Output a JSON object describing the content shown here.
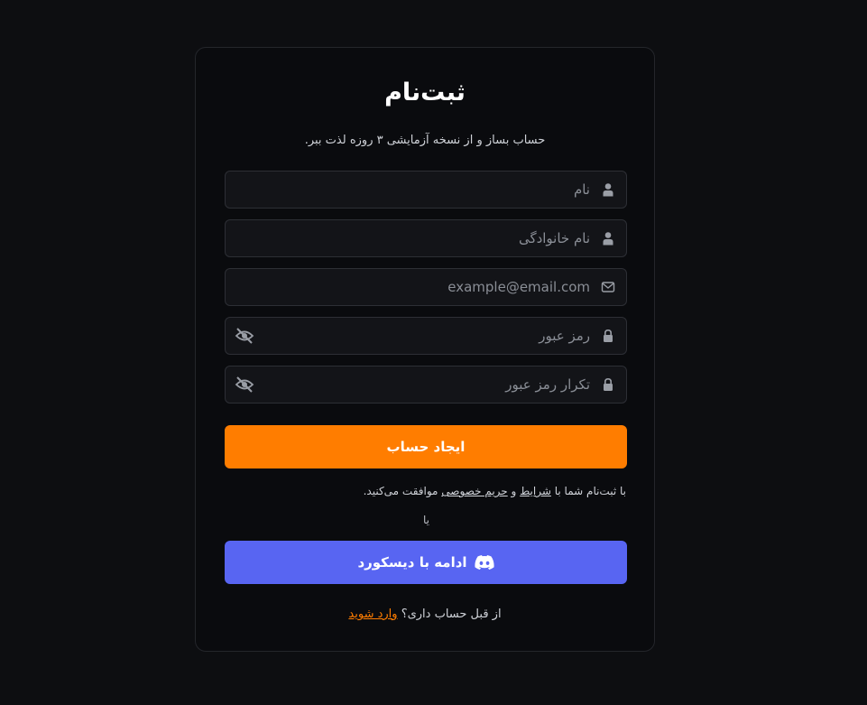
{
  "page": {
    "title": "ثبت‌نام",
    "subtitle": "حساب بساز و از نسخه آزمایشی ۳ روزه لذت ببر."
  },
  "form": {
    "first_name": {
      "placeholder": "نام",
      "value": ""
    },
    "last_name": {
      "placeholder": "نام خانوادگی",
      "value": ""
    },
    "email": {
      "placeholder": "example@email.com",
      "value": ""
    },
    "password": {
      "placeholder": "رمز عبور",
      "value": ""
    },
    "password_confirm": {
      "placeholder": "تکرار رمز عبور",
      "value": ""
    },
    "submit_label": "ایجاد حساب"
  },
  "terms": {
    "prefix": "با ثبت‌نام شما با",
    "terms_link": "شرایط",
    "and": "و",
    "privacy_link": "حریم خصوصی",
    "suffix": "موافقت می‌کنید."
  },
  "divider": {
    "label": "یا"
  },
  "discord": {
    "label": "ادامه با دیسکورد"
  },
  "login": {
    "prompt": "از قبل حساب داری؟",
    "link": "وارد شوید"
  },
  "colors": {
    "accent": "#ff7d00",
    "discord": "#5865f2",
    "background": "#0d0e11",
    "card": "#0a0b0e"
  },
  "icons": {
    "name_field": "user-icon",
    "email_field": "mail-icon",
    "password_field": "lock-icon",
    "toggle_visibility": "eye-off-icon",
    "discord": "discord-icon"
  }
}
